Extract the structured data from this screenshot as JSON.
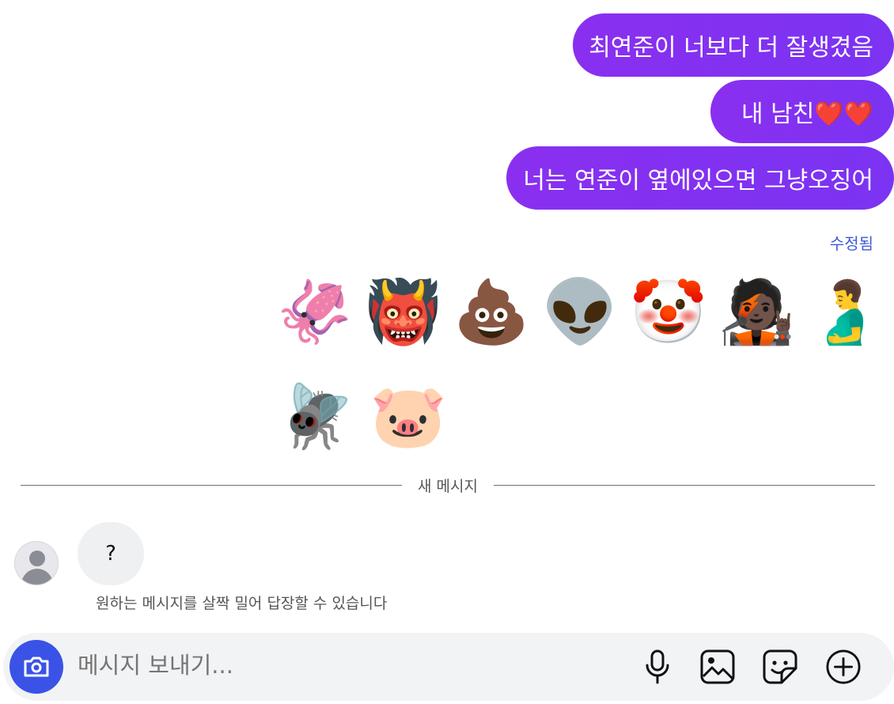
{
  "messages": {
    "outgoing": [
      "최연준이 너보다 더 잘생겼음",
      "내 남친❤️❤️",
      "너는 연준이 옆에있으면 그냥오징어"
    ],
    "edited_label": "수정됨",
    "reactions_emoji": [
      [
        "🦑",
        "👹",
        "💩",
        "👽",
        "🤡",
        "🧑🏿‍🎤",
        "🫃"
      ],
      [
        "🪰",
        "🐷"
      ]
    ]
  },
  "divider": {
    "label": "새 메시지"
  },
  "incoming": {
    "avatar_icon": "person-silhouette-icon",
    "text": "?"
  },
  "hint": "원하는 메시지를 살짝 밀어 답장할 수 있습니다",
  "composer": {
    "placeholder": "메시지 보내기...",
    "icons": [
      "camera-icon",
      "microphone-icon",
      "gallery-icon",
      "sticker-icon",
      "plus-circle-icon"
    ]
  },
  "colors": {
    "bubble": "#8a2ff0",
    "accent": "#3a53e6",
    "edited": "#3f5bd8"
  }
}
